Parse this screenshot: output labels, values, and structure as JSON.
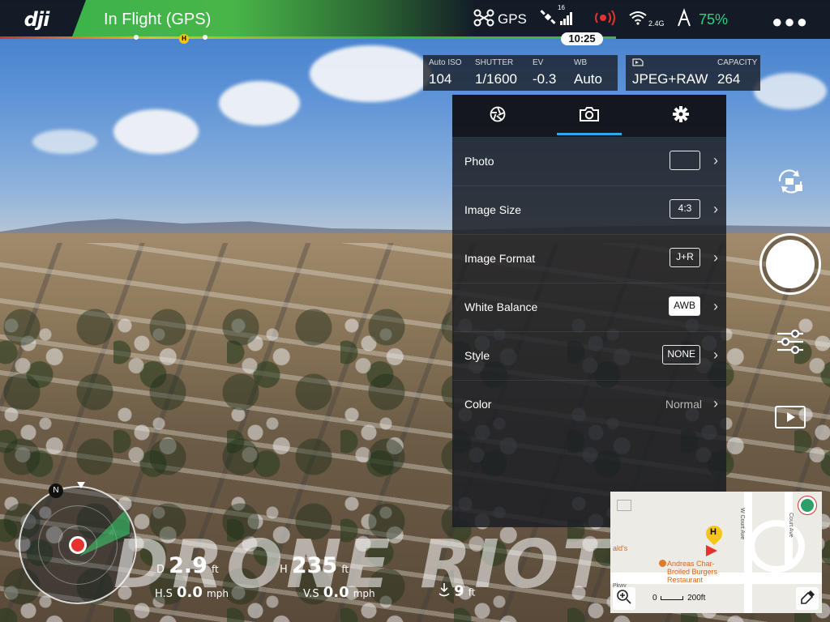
{
  "topbar": {
    "logo": "dji",
    "flight_status": "In Flight (GPS)",
    "gps_label": "GPS",
    "satellite_count": "16",
    "wifi_band": "2.4G",
    "battery_percent": "75%",
    "flight_time": "10:25",
    "home_marker": "H",
    "more_icon": "more-dots-icon",
    "icons": [
      "drone-icon",
      "satellite-icon",
      "signal-bars-icon",
      "record-alert-icon",
      "wifi-icon",
      "battery-icon"
    ],
    "colors": {
      "status_green": "#3cb44a",
      "battery_green": "#35d07f",
      "alert_red": "#e6322e",
      "accent_blue": "#2fa8e8"
    }
  },
  "camera_params": {
    "iso": {
      "label": "Auto ISO",
      "value": "104"
    },
    "shutter": {
      "label": "SHUTTER",
      "value": "1/1600"
    },
    "ev": {
      "label": "EV",
      "value": "-0.3"
    },
    "wb": {
      "label": "WB",
      "value": "Auto"
    },
    "format": {
      "value": "JPEG+RAW"
    },
    "capacity": {
      "label": "CAPACITY",
      "value": "264"
    }
  },
  "settings_panel": {
    "tabs": [
      {
        "icon": "aperture-icon"
      },
      {
        "icon": "camera-icon"
      },
      {
        "icon": "gear-icon"
      }
    ],
    "active_tab": 1,
    "rows": [
      {
        "label": "Photo",
        "value": ""
      },
      {
        "label": "Image Size",
        "value": "4:3"
      },
      {
        "label": "Image Format",
        "value": "J+R"
      },
      {
        "label": "White Balance",
        "value": "AWB"
      },
      {
        "label": "Style",
        "value": "NONE"
      },
      {
        "label": "Color",
        "value": "Normal"
      }
    ]
  },
  "side_controls": {
    "icons": [
      "switch-camera-icon",
      "shutter-button",
      "sliders-icon",
      "playback-icon"
    ]
  },
  "map": {
    "street_1": "W Court Ave",
    "street_2": "Court Ave",
    "poi_name": "Andreas Char-Broiled Burgers Restaurant",
    "poi_line1": "Andreas Char-",
    "poi_line2": "Broiled Burgers",
    "poi_line3": "Restaurant",
    "side_label_1": "ald's",
    "side_label_2": "Pkwy",
    "home_marker": "H",
    "scale_zero": "0",
    "scale_distance": "200ft"
  },
  "telemetry": {
    "distance_label": "D",
    "distance_value": "2.9",
    "distance_unit": "ft",
    "height_label": "H",
    "height_value": "235",
    "height_unit": "ft",
    "hspeed_label": "H.S",
    "hspeed_value": "0.0",
    "hspeed_unit": "mph",
    "vspeed_label": "V.S",
    "vspeed_value": "0.0",
    "vspeed_unit": "mph",
    "vps_value": "9",
    "vps_unit": "ft",
    "compass_north": "N"
  },
  "watermark": "DRONE RIOT"
}
